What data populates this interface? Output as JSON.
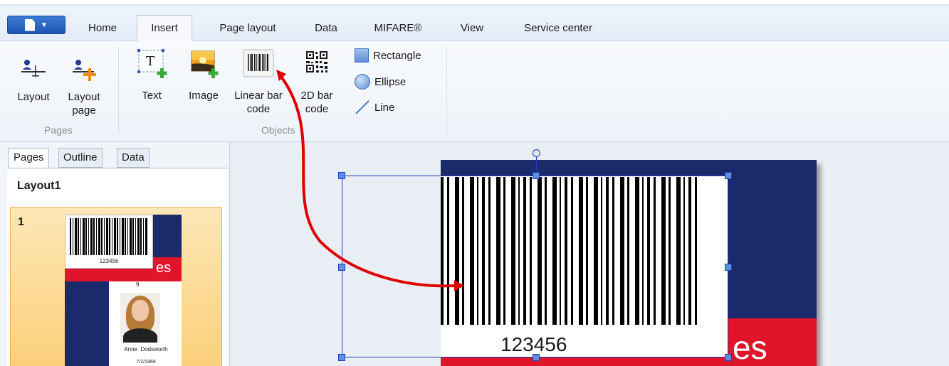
{
  "tabs": [
    {
      "label": "Home"
    },
    {
      "label": "Insert"
    },
    {
      "label": "Page layout"
    },
    {
      "label": "Data"
    },
    {
      "label": "MIFARE®"
    },
    {
      "label": "View"
    },
    {
      "label": "Service center"
    }
  ],
  "ribbon": {
    "layout_label": "Layout",
    "layout_page_label_1": "Layout",
    "layout_page_label_2": "page",
    "pages_group": "Pages",
    "text_label": "Text",
    "image_label": "Image",
    "linear_barcode_label_1": "Linear bar",
    "linear_barcode_label_2": "code",
    "barcode_2d_label_1": "2D bar",
    "barcode_2d_label_2": "code",
    "rectangle_label": "Rectangle",
    "ellipse_label": "Ellipse",
    "line_label": "Line",
    "objects_group": "Objects"
  },
  "left_panel": {
    "tabs": [
      {
        "label": "Pages"
      },
      {
        "label": "Outline"
      },
      {
        "label": "Data"
      }
    ],
    "layout_title": "Layout1",
    "page_number": "1",
    "thumb": {
      "barcode_value": "123456",
      "card_text": "es",
      "small_number": "9",
      "name_first": "Anne",
      "name_last": "Dodsworth",
      "date": "7/2/1969"
    }
  },
  "canvas": {
    "barcode_value": "123456",
    "card_text": "es"
  },
  "colors": {
    "accent_blue": "#1d55b3",
    "card_navy": "#1a2a6b",
    "card_red": "#e0142a",
    "selection_blue": "#1f3fb8",
    "arrow_red": "#e00000"
  }
}
